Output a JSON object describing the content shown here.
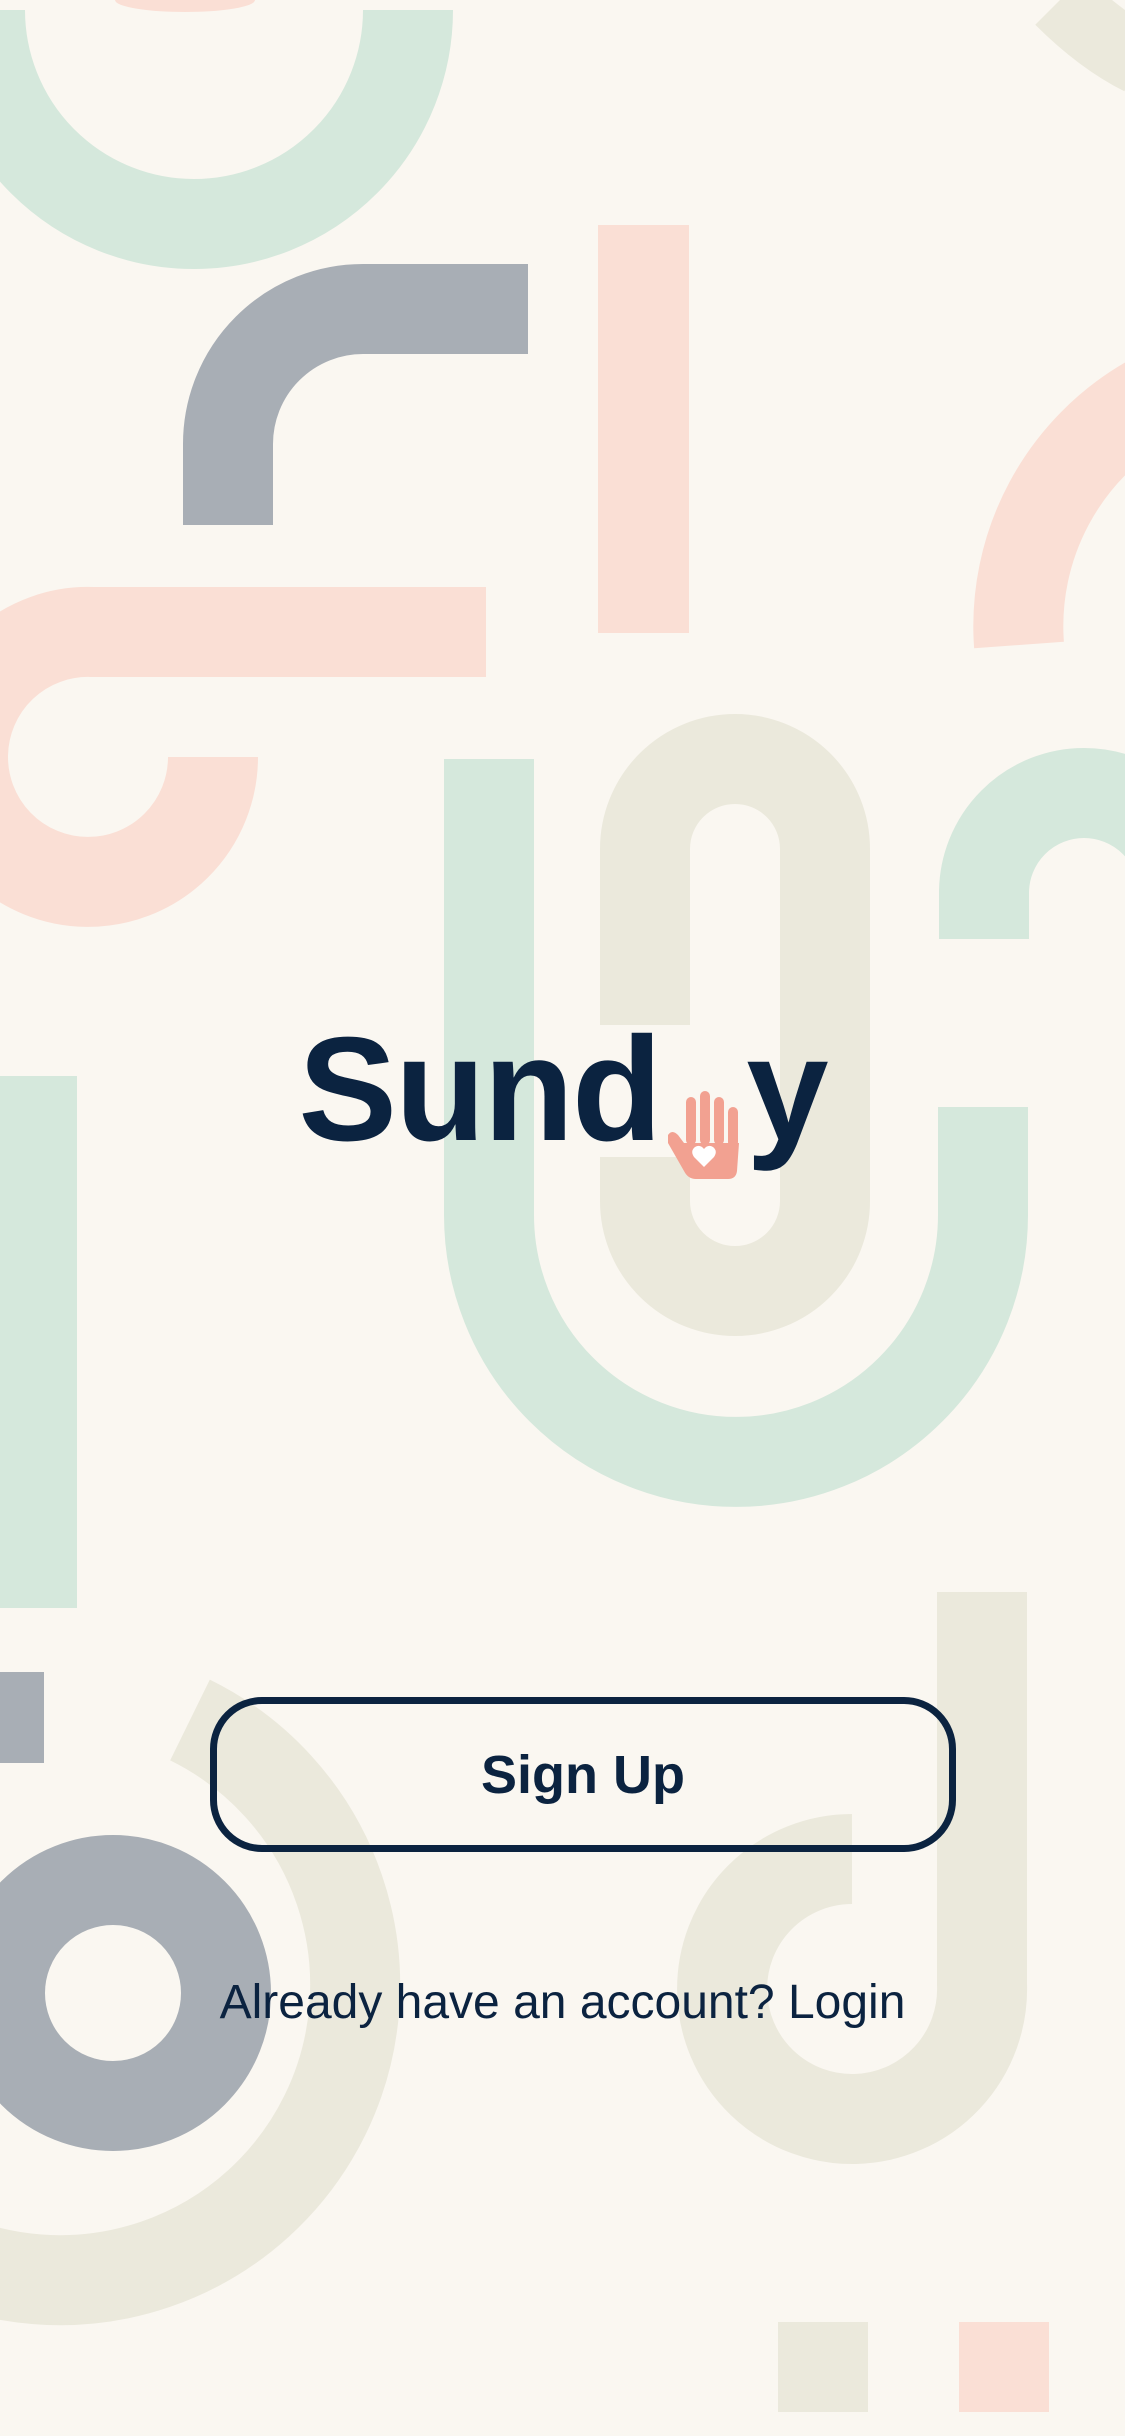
{
  "brand": {
    "name_left": "Sund",
    "name_right": "y",
    "hand_icon": "hand-heart-icon"
  },
  "actions": {
    "signup_label": "Sign Up",
    "login_prompt": "Already have an account? ",
    "login_label": "Login"
  },
  "colors": {
    "background": "#faf7f1",
    "ink": "#0b2340",
    "mint": "#d5e8dc",
    "peach": "#fadfd5",
    "slate": "#a8aeb5",
    "sand": "#ebe9dc",
    "accent": "#f2a191"
  }
}
